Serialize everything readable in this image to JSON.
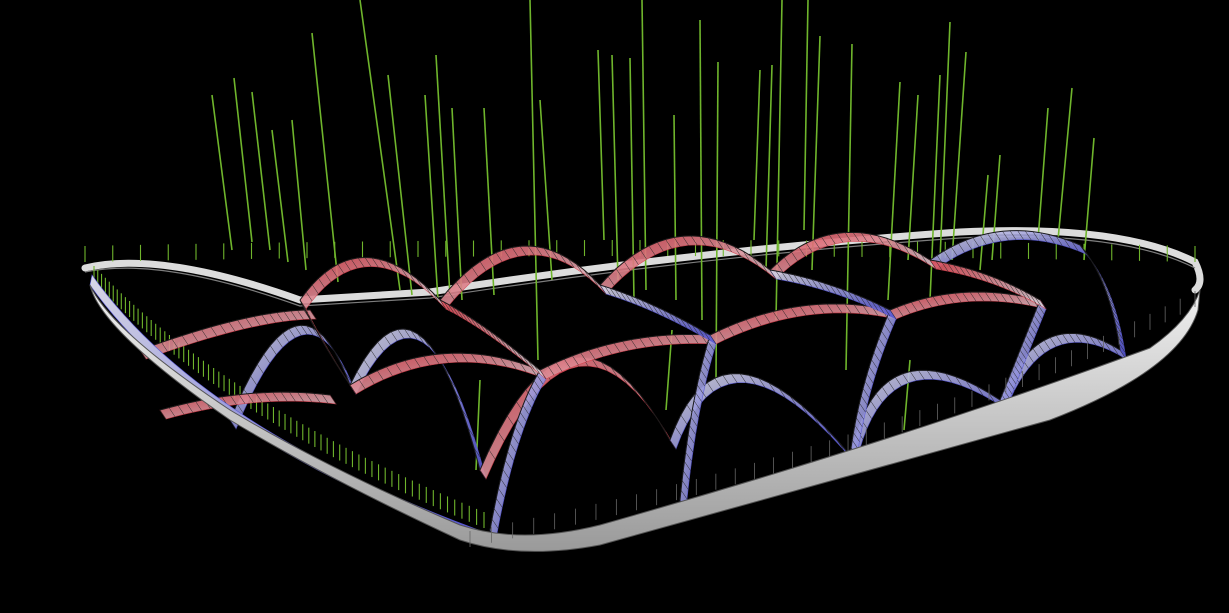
{
  "scene": {
    "background": "#000000",
    "colors": {
      "load_vectors": "#6fb52c",
      "compression": "#5a5ad6",
      "tension": "#d8424f",
      "neutral": "#d9d9e0",
      "ring_beam": "#dcdcdc",
      "ring_beam_dark": "#7d7d7d",
      "ribs_outline": "#1a1a1a"
    },
    "legend_shown": false,
    "axes_shown": false
  }
}
